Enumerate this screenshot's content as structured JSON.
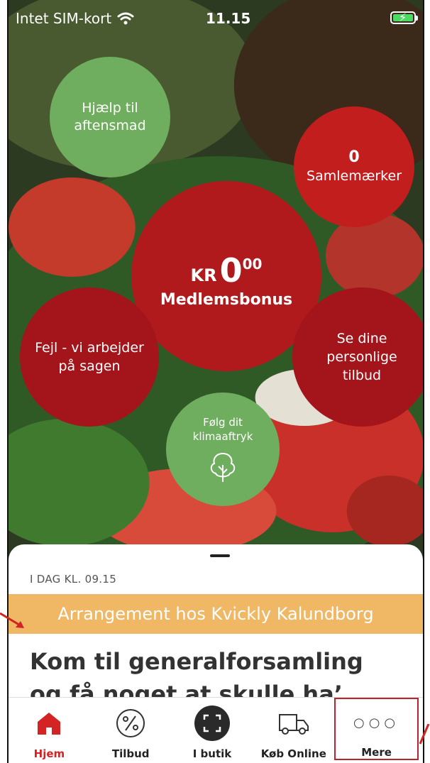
{
  "status_bar": {
    "carrier": "Intet SIM-kort",
    "time": "11.15"
  },
  "bubbles": {
    "help": "Hjælp til aftensmad",
    "stamps_count": "0",
    "stamps_label": "Samlemærker",
    "bonus_currency": "KR",
    "bonus_value": "0",
    "bonus_decimals": "00",
    "bonus_label": "Medlemsbonus",
    "error": "Fejl - vi arbejder på sagen",
    "offers": "Se dine personlige tilbud",
    "climate": "Følg dit klimaaftryk"
  },
  "news": {
    "timestamp": "I DAG KL. 09.15",
    "banner": "Arrangement hos Kvickly Kalundborg",
    "headline": "Kom til generalforsamling og få noget at skulle ha’ sagt"
  },
  "tabs": [
    {
      "label": "Hjem",
      "icon": "home-icon"
    },
    {
      "label": "Tilbud",
      "icon": "percent-icon"
    },
    {
      "label": "I butik",
      "icon": "scan-icon"
    },
    {
      "label": "Køb Online",
      "icon": "truck-icon"
    },
    {
      "label": "Mere",
      "icon": "more-icon"
    }
  ],
  "colors": {
    "brand_red": "#c31e1e",
    "green": "#6fae5f",
    "banner_orange": "#f0b865"
  }
}
